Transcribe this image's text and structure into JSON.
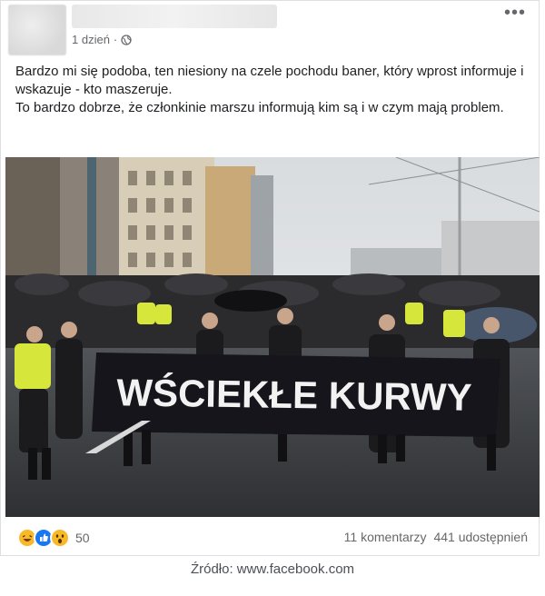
{
  "post": {
    "time": "1 dzień",
    "separator": "·",
    "text_line1": "Bardzo mi się podoba, ten niesiony na czele pochodu baner, który wprost informuje i wskazuje - kto maszeruje.",
    "text_line2": "To bardzo dobrze, że członkinie marszu informują kim są i w czym mają problem.",
    "banner_text": "WŚCIEKŁE KURWY",
    "reactions": [
      "haha-icon",
      "like-icon",
      "wow-icon"
    ],
    "reaction_count": "50",
    "comments": "11 komentarzy",
    "shares": "441 udostępnień"
  },
  "caption": {
    "source": "Źródło: www.facebook.com"
  },
  "colors": {
    "like": "#1877f2",
    "haha": "#f7b928",
    "banner": "#15151b",
    "vest": "#d7e63a"
  }
}
